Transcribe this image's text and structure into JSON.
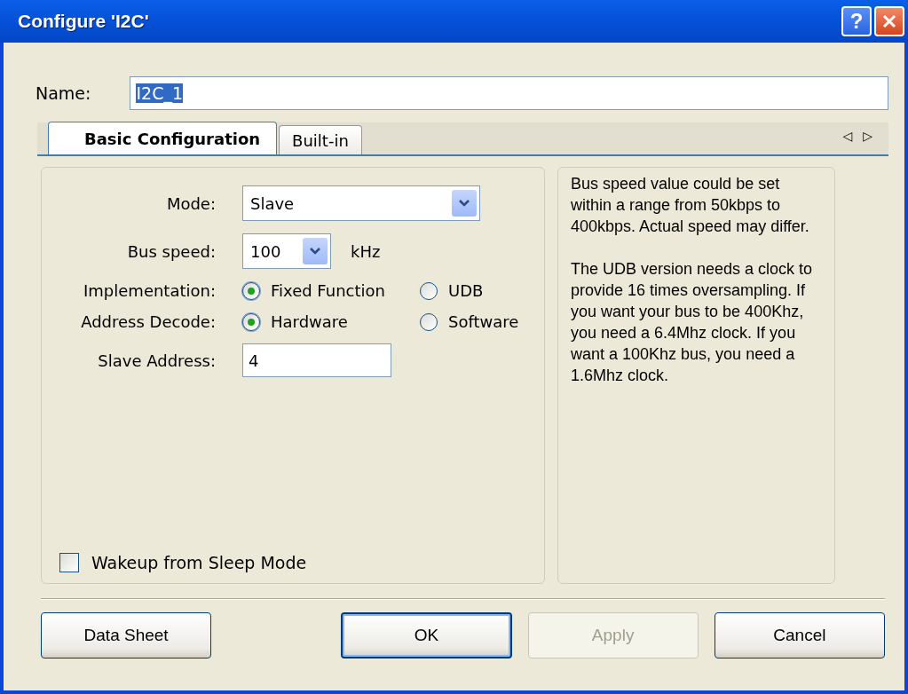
{
  "window": {
    "title": "Configure 'I2C'",
    "help_button": "?"
  },
  "name_field": {
    "label": "Name:",
    "value": "I2C_1"
  },
  "tabs": [
    {
      "label": "Basic Configuration",
      "selected": true
    },
    {
      "label": "Built-in",
      "selected": false
    }
  ],
  "tab_scroll": [
    "◁",
    "▷"
  ],
  "form": {
    "rows": [
      {
        "kind": "select",
        "label": "Mode:",
        "value": "Slave"
      },
      {
        "kind": "select",
        "label": "Bus speed:",
        "value": "100",
        "unit": "kHz"
      },
      {
        "kind": "radio",
        "label": "Implementation:",
        "options": [
          {
            "label": "Fixed Function",
            "selected": true
          },
          {
            "label": "UDB",
            "selected": false
          }
        ]
      },
      {
        "kind": "radio",
        "label": "Address Decode:",
        "options": [
          {
            "label": "Hardware",
            "selected": true
          },
          {
            "label": "Software",
            "selected": false
          }
        ]
      },
      {
        "kind": "text",
        "label": "Slave Address:",
        "value": "4"
      }
    ],
    "checkbox": {
      "label": "Wakeup from Sleep Mode",
      "checked": false
    }
  },
  "help": [
    "Bus speed value could be set within a range from 50kbps to 400kbps. Actual speed may differ.",
    "The UDB version needs a clock to provide 16 times oversampling. If you want your bus to be 400Khz, you need a 6.4Mhz clock. If you want a 100Khz bus, you need a 1.6Mhz clock."
  ],
  "buttons": [
    {
      "label": "Data Sheet",
      "disabled": false,
      "default": false
    },
    {
      "label": "OK",
      "disabled": false,
      "default": true
    },
    {
      "label": "Apply",
      "disabled": true,
      "default": false
    },
    {
      "label": "Cancel",
      "disabled": false,
      "default": false
    }
  ]
}
